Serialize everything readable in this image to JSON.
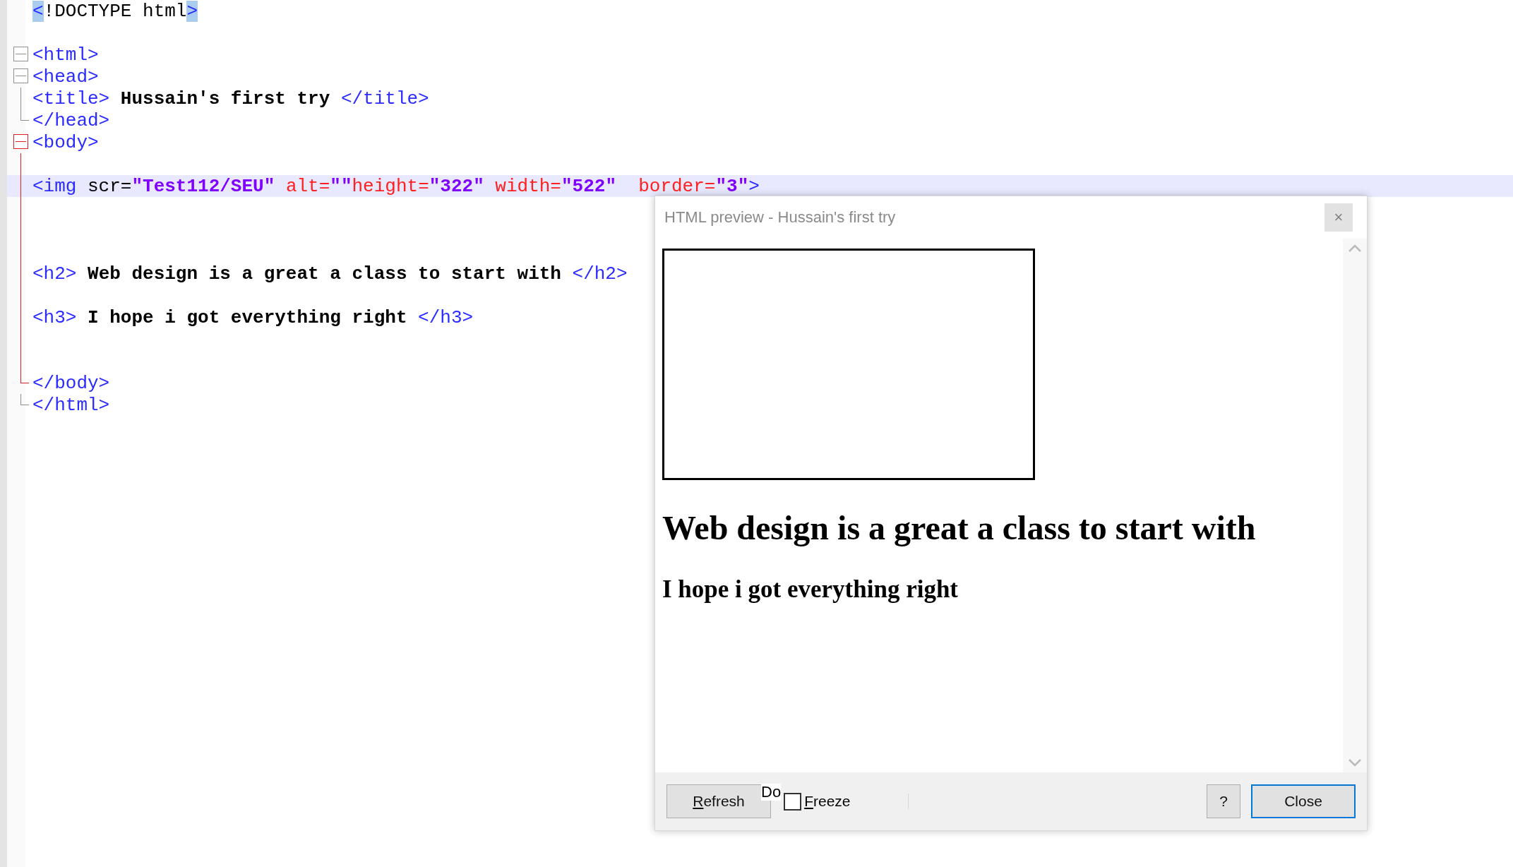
{
  "editor": {
    "lines": [
      {
        "kind": "plain",
        "current": false,
        "tokens": [
          {
            "kind": "tag",
            "text": "<",
            "matched": true
          },
          {
            "kind": "plain",
            "text": "!DOCTYPE html",
            "matched": false
          },
          {
            "kind": "tag",
            "text": ">",
            "matched": true
          }
        ]
      },
      {
        "kind": "plain",
        "current": false
      },
      {
        "kind": "open",
        "color": "#909090",
        "current": false,
        "tokens": [
          {
            "kind": "tag",
            "text": "<html>",
            "matched": false
          }
        ]
      },
      {
        "kind": "open",
        "color": "#909090",
        "current": false,
        "tokens": [
          {
            "kind": "tag",
            "text": "<head>",
            "matched": false
          }
        ]
      },
      {
        "kind": "line",
        "color": "#909090",
        "current": false,
        "tokens": [
          {
            "kind": "tag",
            "text": "<title>",
            "matched": false
          },
          {
            "kind": "text",
            "text": " Hussain's first try ",
            "matched": false
          },
          {
            "kind": "tag",
            "text": "</title>",
            "matched": false
          }
        ]
      },
      {
        "kind": "close",
        "color": "#909090",
        "current": false,
        "tokens": [
          {
            "kind": "tag",
            "text": "</head>",
            "matched": false
          }
        ]
      },
      {
        "kind": "open",
        "color": "#e02020",
        "current": false,
        "tokens": [
          {
            "kind": "tag",
            "text": "<body>",
            "matched": false
          }
        ]
      },
      {
        "kind": "line",
        "color": "#e02020",
        "current": false
      },
      {
        "kind": "line",
        "color": "#e02020",
        "current": true,
        "tokens": [
          {
            "kind": "tag",
            "text": "<img ",
            "matched": false
          },
          {
            "kind": "plain",
            "text": "scr=",
            "matched": false
          },
          {
            "kind": "value",
            "text": "\"Test112/SEU\"",
            "matched": false
          },
          {
            "kind": "attr",
            "text": " alt=",
            "matched": false
          },
          {
            "kind": "value",
            "text": "\"\"",
            "matched": false
          },
          {
            "kind": "attr",
            "text": "height=",
            "matched": false
          },
          {
            "kind": "value",
            "text": "\"322\"",
            "matched": false
          },
          {
            "kind": "attr",
            "text": " width=",
            "matched": false
          },
          {
            "kind": "value",
            "text": "\"522\"",
            "matched": false
          },
          {
            "kind": "attr",
            "text": "  border=",
            "matched": false
          },
          {
            "kind": "value",
            "text": "\"3\"",
            "matched": false
          },
          {
            "kind": "tag",
            "text": ">",
            "matched": false
          }
        ]
      },
      {
        "kind": "line",
        "color": "#e02020",
        "current": false
      },
      {
        "kind": "line",
        "color": "#e02020",
        "current": false
      },
      {
        "kind": "line",
        "color": "#e02020",
        "current": false
      },
      {
        "kind": "line",
        "color": "#e02020",
        "current": false,
        "tokens": [
          {
            "kind": "tag",
            "text": "<h2>",
            "matched": false
          },
          {
            "kind": "text",
            "text": " Web design is a great a class to start with ",
            "matched": false
          },
          {
            "kind": "tag",
            "text": "</h2>",
            "matched": false
          }
        ]
      },
      {
        "kind": "line",
        "color": "#e02020",
        "current": false
      },
      {
        "kind": "line",
        "color": "#e02020",
        "current": false,
        "tokens": [
          {
            "kind": "tag",
            "text": "<h3>",
            "matched": false
          },
          {
            "kind": "text",
            "text": " I hope i got everything right ",
            "matched": false
          },
          {
            "kind": "tag",
            "text": "</h3>",
            "matched": false
          }
        ]
      },
      {
        "kind": "line",
        "color": "#e02020",
        "current": false
      },
      {
        "kind": "line",
        "color": "#e02020",
        "current": false
      },
      {
        "kind": "close",
        "color": "#e02020",
        "current": false,
        "tokens": [
          {
            "kind": "tag",
            "text": "</body>",
            "matched": false
          }
        ]
      },
      {
        "kind": "close",
        "color": "#909090",
        "current": false,
        "tokens": [
          {
            "kind": "tag",
            "text": "</html>",
            "matched": false
          }
        ]
      }
    ]
  },
  "preview_dialog": {
    "title": "HTML preview - Hussain's first try",
    "close_glyph": "×",
    "content": {
      "image_border": true,
      "h2": "Web design is a great a class to start with",
      "h3": "I hope i got everything right"
    },
    "footer": {
      "refresh": {
        "label": "Refresh",
        "mnemonic": true
      },
      "overlap_fragment": "Do",
      "freeze": {
        "label": "Freeze",
        "mnemonic": true,
        "checked": false
      },
      "help": {
        "label": "?"
      },
      "close": {
        "label": "Close",
        "default": true
      }
    }
  }
}
